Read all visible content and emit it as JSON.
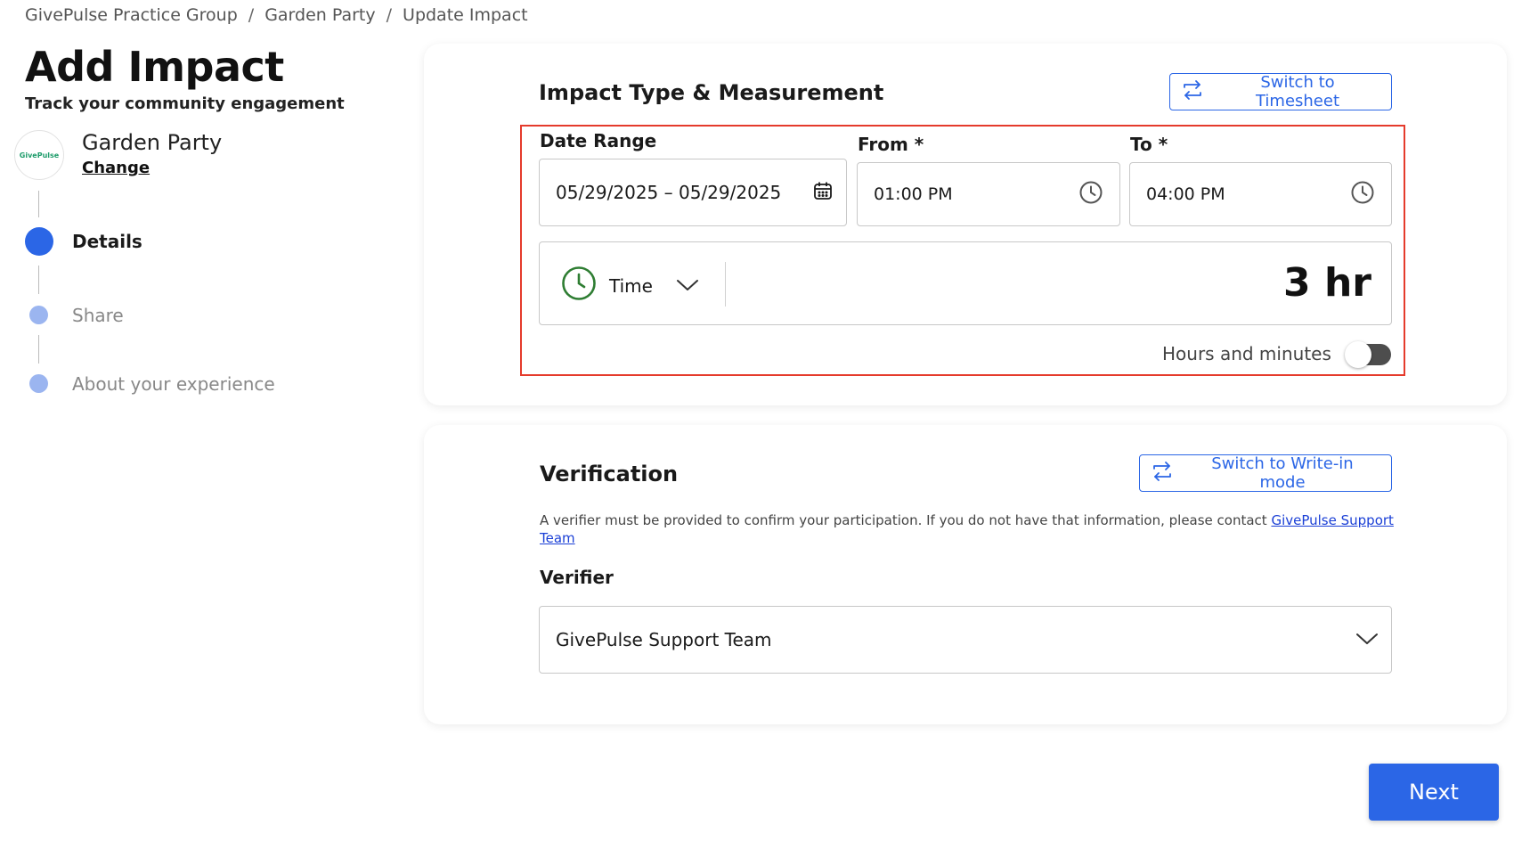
{
  "breadcrumb": {
    "items": [
      "GivePulse Practice Group",
      "Garden Party",
      "Update Impact"
    ],
    "separator": "/"
  },
  "page": {
    "title": "Add Impact",
    "subtitle": "Track your community engagement"
  },
  "org": {
    "logo_text": "GivePulse",
    "name": "Garden Party",
    "change_label": "Change"
  },
  "steps": [
    {
      "label": "Details",
      "state": "active"
    },
    {
      "label": "Share",
      "state": "pending"
    },
    {
      "label": "About your experience",
      "state": "pending"
    }
  ],
  "impact": {
    "title": "Impact Type & Measurement",
    "switch_label": "Switch to Timesheet",
    "date_range_label": "Date Range",
    "date_range_value": "05/29/2025 – 05/29/2025",
    "from_label": "From *",
    "from_value": "01:00 PM",
    "to_label": "To *",
    "to_value": "04:00 PM",
    "type_label": "Time",
    "measure_value": "3 hr",
    "toggle_label": "Hours and minutes",
    "toggle_on": false
  },
  "verification": {
    "title": "Verification",
    "switch_label": "Switch to Write-in mode",
    "description": "A verifier must be provided to confirm your participation. If you do not have that information, please contact ",
    "link_text": "GivePulse Support Team",
    "verifier_label": "Verifier",
    "verifier_value": "GivePulse Support Team"
  },
  "actions": {
    "next_label": "Next"
  },
  "colors": {
    "accent": "#2b66e6",
    "highlight": "#e53b2c",
    "clock_green": "#2e7d32",
    "step_pending": "#9bb5f0"
  }
}
